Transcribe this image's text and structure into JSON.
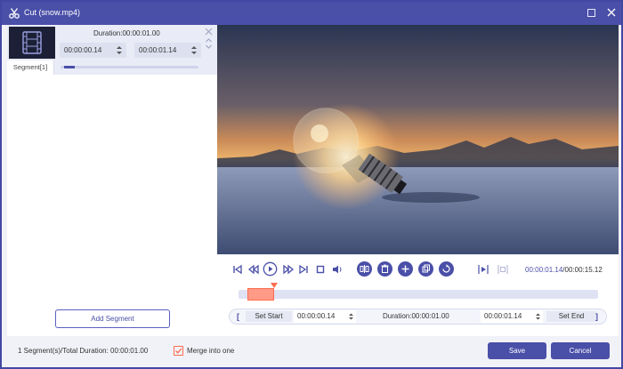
{
  "window": {
    "title": "Cut (snow.mp4)",
    "accent_color": "#4a4fa8",
    "highlight_color": "#ff6a4e"
  },
  "segment": {
    "label": "Segment[1]",
    "duration": "Duration:00:00:01.00",
    "start": "00:00:00.14",
    "end": "00:00:01.14"
  },
  "left": {
    "add_segment_label": "Add Segment"
  },
  "player": {
    "current_time": "00:00:01.14",
    "separator": "/",
    "total_time": "00:00:15.12"
  },
  "range": {
    "set_start_label": "Set Start",
    "start_value": "00:00:00.14",
    "duration": "Duration:00:00:01.00",
    "end_value": "00:00:01.14",
    "set_end_label": "Set End",
    "open_bracket": "[",
    "close_bracket": "]"
  },
  "footer": {
    "summary": "1 Segment(s)/Total Duration: 00:00:01.00",
    "merge_label": "Merge into one",
    "merge_checked": true,
    "save_label": "Save",
    "cancel_label": "Cancel"
  }
}
